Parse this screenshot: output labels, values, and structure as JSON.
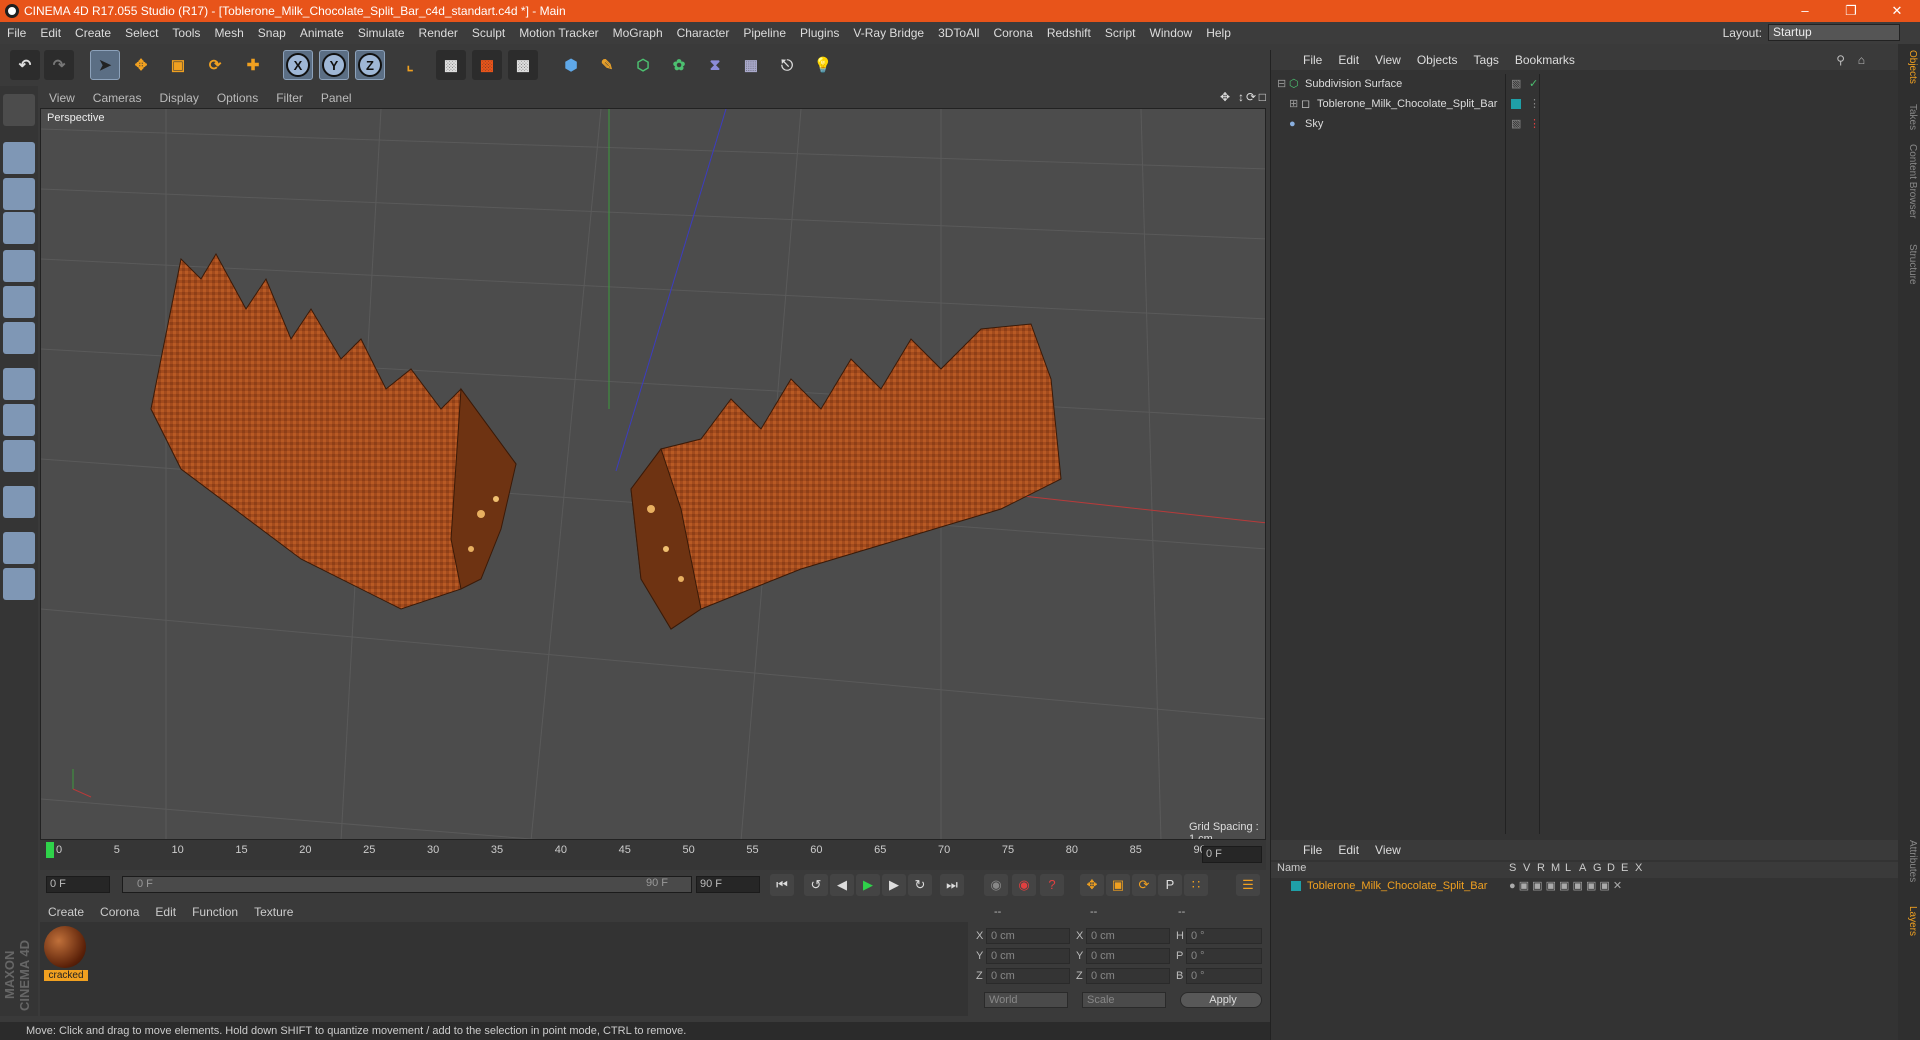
{
  "window": {
    "title": "CINEMA 4D R17.055 Studio (R17) - [Toblerone_Milk_Chocolate_Split_Bar_c4d_standart.c4d *] - Main"
  },
  "menubar": {
    "items": [
      "File",
      "Edit",
      "Create",
      "Select",
      "Tools",
      "Mesh",
      "Snap",
      "Animate",
      "Simulate",
      "Render",
      "Sculpt",
      "Motion Tracker",
      "MoGraph",
      "Character",
      "Pipeline",
      "Plugins",
      "V-Ray Bridge",
      "3DToAll",
      "Corona",
      "Redshift",
      "Script",
      "Window",
      "Help"
    ],
    "layout_label": "Layout:",
    "layout_value": "Startup"
  },
  "viewport": {
    "menu": [
      "View",
      "Cameras",
      "Display",
      "Options",
      "Filter",
      "Panel"
    ],
    "label": "Perspective",
    "grid_spacing": "Grid Spacing : 1 cm"
  },
  "timeline": {
    "ticks": [
      "0",
      "5",
      "10",
      "15",
      "20",
      "25",
      "30",
      "35",
      "40",
      "45",
      "50",
      "55",
      "60",
      "65",
      "70",
      "75",
      "80",
      "85",
      "90"
    ],
    "current_frame": "0 F",
    "start_frame": "0 F",
    "range_start": "0 F",
    "range_end": "90 F",
    "end_frame": "90 F"
  },
  "material_panel": {
    "menu": [
      "Create",
      "Corona",
      "Edit",
      "Function",
      "Texture"
    ],
    "materials": [
      {
        "name": "cracked"
      }
    ]
  },
  "coordinates": {
    "headers": [
      "--",
      "--",
      "--"
    ],
    "rows": [
      {
        "l1": "X",
        "v1": "0 cm",
        "l2": "X",
        "v2": "0 cm",
        "l3": "H",
        "v3": "0 °"
      },
      {
        "l1": "Y",
        "v1": "0 cm",
        "l2": "Y",
        "v2": "0 cm",
        "l3": "P",
        "v3": "0 °"
      },
      {
        "l1": "Z",
        "v1": "0 cm",
        "l2": "Z",
        "v2": "0 cm",
        "l3": "B",
        "v3": "0 °"
      }
    ],
    "world": "World",
    "scale": "Scale",
    "apply": "Apply"
  },
  "object_manager": {
    "menu": [
      "File",
      "Edit",
      "View",
      "Objects",
      "Tags",
      "Bookmarks"
    ],
    "objects": [
      {
        "name": "Subdivision Surface"
      },
      {
        "name": "Toblerone_Milk_Chocolate_Split_Bar"
      },
      {
        "name": "Sky"
      }
    ]
  },
  "layer_manager": {
    "menu": [
      "File",
      "Edit",
      "View"
    ],
    "columns": [
      "Name",
      "S",
      "V",
      "R",
      "M",
      "L",
      "A",
      "G",
      "D",
      "E",
      "X"
    ],
    "row": "Toblerone_Milk_Chocolate_Split_Bar"
  },
  "right_tabs": [
    "Objects",
    "Takes",
    "Content Browser",
    "Structure",
    "Attributes",
    "Layers"
  ],
  "brand": "MAXON CINEMA 4D",
  "status": "Move: Click and drag to move elements. Hold down SHIFT to quantize movement / add to the selection in point mode, CTRL to remove.",
  "colors": {
    "titlebar": "#e8541a",
    "chocolate": "#a04a1c",
    "accent": "#f0a020",
    "layer_teal": "#1fa0a8"
  }
}
